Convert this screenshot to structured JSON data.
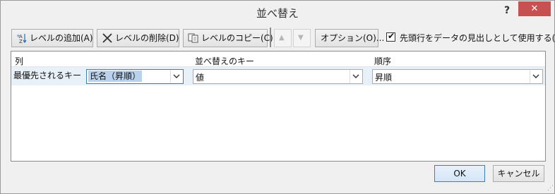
{
  "window": {
    "title": "並べ替え",
    "help_glyph": "?",
    "close_glyph": "✕"
  },
  "toolbar": {
    "add_level": "レベルの追加(A)",
    "delete_level": "レベルの削除(D)",
    "copy_level": "レベルのコピー(C)",
    "move_up_glyph": "▲",
    "move_down_glyph": "▼",
    "options": "オプション(O)...",
    "header_checkbox_label": "先頭行をデータの見出しとして使用する(H)",
    "header_checkbox_checked": true,
    "check_glyph": "✔"
  },
  "grid": {
    "headers": {
      "column": "列",
      "sort_on": "並べ替えのキー",
      "order": "順序"
    },
    "rows": [
      {
        "label": "最優先されるキー",
        "column_value": "氏名（昇順）",
        "sort_on_value": "値",
        "order_value": "昇順"
      }
    ]
  },
  "footer": {
    "ok": "OK",
    "cancel": "キャンセル",
    "grip_glyph": "⋰"
  },
  "colors": {
    "close_button": "#c75050",
    "focus_blue": "#3c7fb1",
    "selection": "#b9d1ea"
  }
}
